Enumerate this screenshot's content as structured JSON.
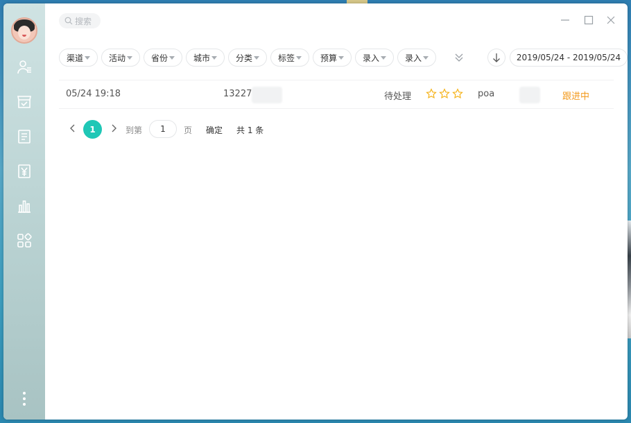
{
  "search": {
    "placeholder": "搜索",
    "icon": "search-icon"
  },
  "sidebar": {
    "items": [
      {
        "icon": "customer-icon"
      },
      {
        "icon": "store-check-icon"
      },
      {
        "icon": "document-icon"
      },
      {
        "icon": "yuan-receipt-icon"
      },
      {
        "icon": "bar-chart-icon"
      },
      {
        "icon": "apps-grid-icon"
      }
    ],
    "more_icon": "more-vertical-icon"
  },
  "filters": {
    "chips": [
      {
        "label": "渠道"
      },
      {
        "label": "活动"
      },
      {
        "label": "省份"
      },
      {
        "label": "城市"
      },
      {
        "label": "分类"
      },
      {
        "label": "标签"
      },
      {
        "label": "预算"
      },
      {
        "label": "录入"
      },
      {
        "label": "录入"
      }
    ],
    "date_range": "2019/05/24 - 2019/05/24"
  },
  "records": [
    {
      "time": "05/24 19:18",
      "phone": "13227",
      "state": "待处理",
      "rating": 0,
      "rating_max": 3,
      "owner": "poa",
      "follow_status": "跟进中"
    }
  ],
  "pagination": {
    "current_page": "1",
    "goto_label": "到第",
    "page_input_value": "1",
    "page_suffix": "页",
    "confirm_label": "确定",
    "total_label": "共 1 条"
  },
  "colors": {
    "accent": "#1fc7b6",
    "star": "#f5b31b",
    "follow_status": "#f39a1d"
  }
}
